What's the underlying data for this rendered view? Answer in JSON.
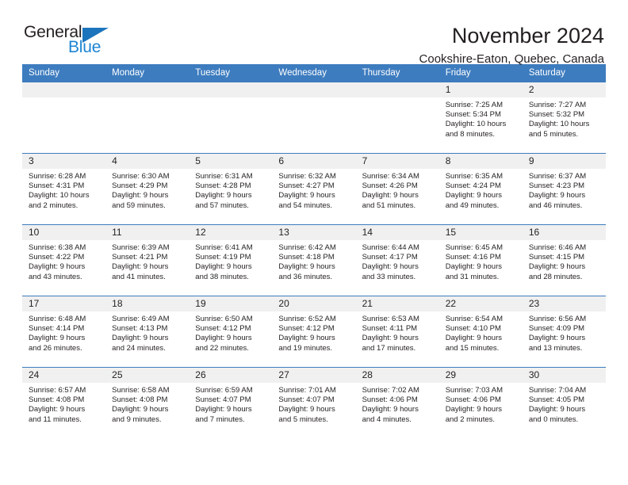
{
  "logo": {
    "word_top": "General",
    "word_bottom": "Blue",
    "triangle_icon": "triangle-icon",
    "blue": "#1c85d4",
    "dark": "#231f20"
  },
  "header": {
    "title": "November 2024",
    "subtitle": "Cookshire-Eaton, Quebec, Canada"
  },
  "theme": {
    "header_bg": "#3d7cbf",
    "daynum_bg": "#f0f0f0",
    "text": "#231f20"
  },
  "calendar": {
    "weekdays": [
      "Sunday",
      "Monday",
      "Tuesday",
      "Wednesday",
      "Thursday",
      "Friday",
      "Saturday"
    ],
    "weeks": [
      [
        {
          "day": "",
          "empty": true
        },
        {
          "day": "",
          "empty": true
        },
        {
          "day": "",
          "empty": true
        },
        {
          "day": "",
          "empty": true
        },
        {
          "day": "",
          "empty": true
        },
        {
          "day": "1",
          "sunrise": "Sunrise: 7:25 AM",
          "sunset": "Sunset: 5:34 PM",
          "daylight1": "Daylight: 10 hours",
          "daylight2": "and 8 minutes."
        },
        {
          "day": "2",
          "sunrise": "Sunrise: 7:27 AM",
          "sunset": "Sunset: 5:32 PM",
          "daylight1": "Daylight: 10 hours",
          "daylight2": "and 5 minutes."
        }
      ],
      [
        {
          "day": "3",
          "sunrise": "Sunrise: 6:28 AM",
          "sunset": "Sunset: 4:31 PM",
          "daylight1": "Daylight: 10 hours",
          "daylight2": "and 2 minutes."
        },
        {
          "day": "4",
          "sunrise": "Sunrise: 6:30 AM",
          "sunset": "Sunset: 4:29 PM",
          "daylight1": "Daylight: 9 hours",
          "daylight2": "and 59 minutes."
        },
        {
          "day": "5",
          "sunrise": "Sunrise: 6:31 AM",
          "sunset": "Sunset: 4:28 PM",
          "daylight1": "Daylight: 9 hours",
          "daylight2": "and 57 minutes."
        },
        {
          "day": "6",
          "sunrise": "Sunrise: 6:32 AM",
          "sunset": "Sunset: 4:27 PM",
          "daylight1": "Daylight: 9 hours",
          "daylight2": "and 54 minutes."
        },
        {
          "day": "7",
          "sunrise": "Sunrise: 6:34 AM",
          "sunset": "Sunset: 4:26 PM",
          "daylight1": "Daylight: 9 hours",
          "daylight2": "and 51 minutes."
        },
        {
          "day": "8",
          "sunrise": "Sunrise: 6:35 AM",
          "sunset": "Sunset: 4:24 PM",
          "daylight1": "Daylight: 9 hours",
          "daylight2": "and 49 minutes."
        },
        {
          "day": "9",
          "sunrise": "Sunrise: 6:37 AM",
          "sunset": "Sunset: 4:23 PM",
          "daylight1": "Daylight: 9 hours",
          "daylight2": "and 46 minutes."
        }
      ],
      [
        {
          "day": "10",
          "sunrise": "Sunrise: 6:38 AM",
          "sunset": "Sunset: 4:22 PM",
          "daylight1": "Daylight: 9 hours",
          "daylight2": "and 43 minutes."
        },
        {
          "day": "11",
          "sunrise": "Sunrise: 6:39 AM",
          "sunset": "Sunset: 4:21 PM",
          "daylight1": "Daylight: 9 hours",
          "daylight2": "and 41 minutes."
        },
        {
          "day": "12",
          "sunrise": "Sunrise: 6:41 AM",
          "sunset": "Sunset: 4:19 PM",
          "daylight1": "Daylight: 9 hours",
          "daylight2": "and 38 minutes."
        },
        {
          "day": "13",
          "sunrise": "Sunrise: 6:42 AM",
          "sunset": "Sunset: 4:18 PM",
          "daylight1": "Daylight: 9 hours",
          "daylight2": "and 36 minutes."
        },
        {
          "day": "14",
          "sunrise": "Sunrise: 6:44 AM",
          "sunset": "Sunset: 4:17 PM",
          "daylight1": "Daylight: 9 hours",
          "daylight2": "and 33 minutes."
        },
        {
          "day": "15",
          "sunrise": "Sunrise: 6:45 AM",
          "sunset": "Sunset: 4:16 PM",
          "daylight1": "Daylight: 9 hours",
          "daylight2": "and 31 minutes."
        },
        {
          "day": "16",
          "sunrise": "Sunrise: 6:46 AM",
          "sunset": "Sunset: 4:15 PM",
          "daylight1": "Daylight: 9 hours",
          "daylight2": "and 28 minutes."
        }
      ],
      [
        {
          "day": "17",
          "sunrise": "Sunrise: 6:48 AM",
          "sunset": "Sunset: 4:14 PM",
          "daylight1": "Daylight: 9 hours",
          "daylight2": "and 26 minutes."
        },
        {
          "day": "18",
          "sunrise": "Sunrise: 6:49 AM",
          "sunset": "Sunset: 4:13 PM",
          "daylight1": "Daylight: 9 hours",
          "daylight2": "and 24 minutes."
        },
        {
          "day": "19",
          "sunrise": "Sunrise: 6:50 AM",
          "sunset": "Sunset: 4:12 PM",
          "daylight1": "Daylight: 9 hours",
          "daylight2": "and 22 minutes."
        },
        {
          "day": "20",
          "sunrise": "Sunrise: 6:52 AM",
          "sunset": "Sunset: 4:12 PM",
          "daylight1": "Daylight: 9 hours",
          "daylight2": "and 19 minutes."
        },
        {
          "day": "21",
          "sunrise": "Sunrise: 6:53 AM",
          "sunset": "Sunset: 4:11 PM",
          "daylight1": "Daylight: 9 hours",
          "daylight2": "and 17 minutes."
        },
        {
          "day": "22",
          "sunrise": "Sunrise: 6:54 AM",
          "sunset": "Sunset: 4:10 PM",
          "daylight1": "Daylight: 9 hours",
          "daylight2": "and 15 minutes."
        },
        {
          "day": "23",
          "sunrise": "Sunrise: 6:56 AM",
          "sunset": "Sunset: 4:09 PM",
          "daylight1": "Daylight: 9 hours",
          "daylight2": "and 13 minutes."
        }
      ],
      [
        {
          "day": "24",
          "sunrise": "Sunrise: 6:57 AM",
          "sunset": "Sunset: 4:08 PM",
          "daylight1": "Daylight: 9 hours",
          "daylight2": "and 11 minutes."
        },
        {
          "day": "25",
          "sunrise": "Sunrise: 6:58 AM",
          "sunset": "Sunset: 4:08 PM",
          "daylight1": "Daylight: 9 hours",
          "daylight2": "and 9 minutes."
        },
        {
          "day": "26",
          "sunrise": "Sunrise: 6:59 AM",
          "sunset": "Sunset: 4:07 PM",
          "daylight1": "Daylight: 9 hours",
          "daylight2": "and 7 minutes."
        },
        {
          "day": "27",
          "sunrise": "Sunrise: 7:01 AM",
          "sunset": "Sunset: 4:07 PM",
          "daylight1": "Daylight: 9 hours",
          "daylight2": "and 5 minutes."
        },
        {
          "day": "28",
          "sunrise": "Sunrise: 7:02 AM",
          "sunset": "Sunset: 4:06 PM",
          "daylight1": "Daylight: 9 hours",
          "daylight2": "and 4 minutes."
        },
        {
          "day": "29",
          "sunrise": "Sunrise: 7:03 AM",
          "sunset": "Sunset: 4:06 PM",
          "daylight1": "Daylight: 9 hours",
          "daylight2": "and 2 minutes."
        },
        {
          "day": "30",
          "sunrise": "Sunrise: 7:04 AM",
          "sunset": "Sunset: 4:05 PM",
          "daylight1": "Daylight: 9 hours",
          "daylight2": "and 0 minutes."
        }
      ]
    ]
  }
}
